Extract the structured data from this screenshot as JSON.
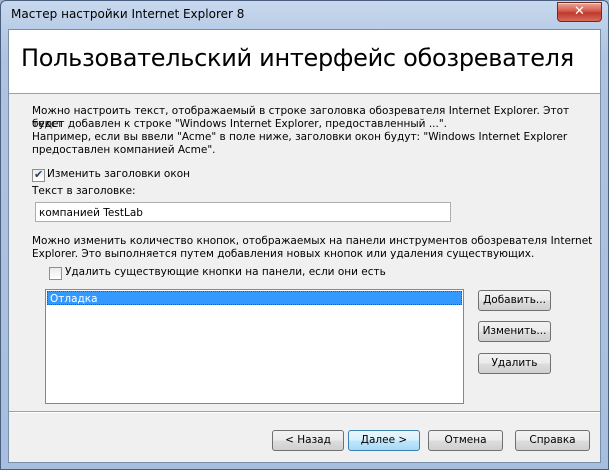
{
  "window": {
    "title": "Мастер настройки Internet Explorer 8",
    "close_glyph": "✕"
  },
  "header": {
    "title": "Пользовательский интерфейс обозревателя"
  },
  "intro": [
    "Можно настроить текст, отображаемый в строке заголовка обозревателя Internet Explorer. Этот текст",
    "будет добавлен к строке \"Windows Internet Explorer, предоставленный ...\".",
    "Например, если вы ввели \"Acme\" в поле ниже, заголовки окон будут: \"Windows Internet Explorer",
    "предоставлен компанией Acme\"."
  ],
  "change_titles": {
    "label": "Изменить заголовки окон",
    "checked": true
  },
  "title_text": {
    "label": "Текст в заголовке:",
    "value": "компанией TestLab"
  },
  "toolbar_info": [
    "Можно изменить количество кнопок, отображаемых на панели инструментов обозревателя Internet",
    "Explorer. Это выполняется путем добавления новых кнопок или удаления существующих."
  ],
  "delete_existing": {
    "label": "Удалить существующие кнопки на панели, если они есть",
    "checked": false
  },
  "buttons_list": {
    "items": [
      "Отладка"
    ]
  },
  "side_buttons": {
    "add": "Добавить...",
    "edit": "Изменить...",
    "delete": "Удалить"
  },
  "footer": {
    "back": "< Назад",
    "next": "Далее >",
    "cancel": "Отмена",
    "help": "Справка"
  }
}
